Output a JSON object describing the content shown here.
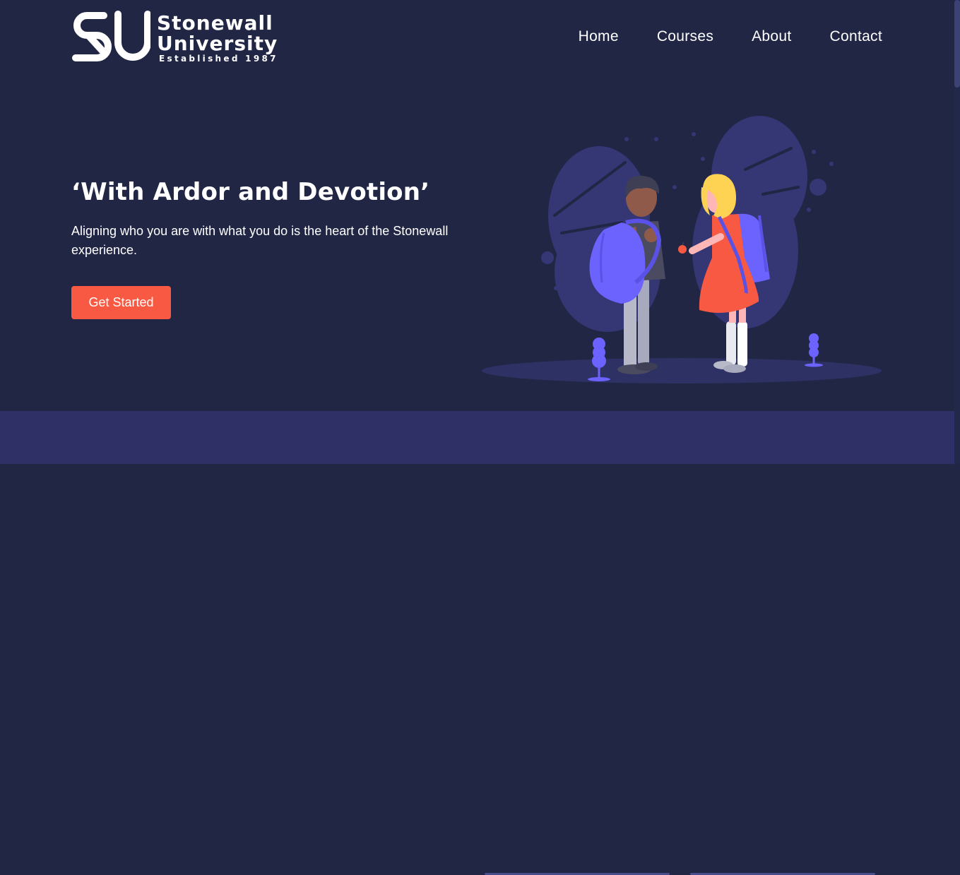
{
  "brand": {
    "name_line1": "Stonewall",
    "name_line2": "University",
    "established": "Established 1987",
    "monogram": "SU"
  },
  "nav": {
    "items": [
      {
        "label": "Home"
      },
      {
        "label": "Courses"
      },
      {
        "label": "About"
      },
      {
        "label": "Contact"
      }
    ]
  },
  "hero": {
    "title": "‘With Ardor and Devotion’",
    "text": "Aligning who you are with what you do is the heart of the Stonewall experience.",
    "cta_label": "Get Started"
  },
  "colors": {
    "background": "#212645",
    "accent": "#f75942",
    "illustration_purple": "#6c63ff",
    "section_band": "#2f3066"
  },
  "icons": [
    "su-monogram-logo",
    "students-illustration"
  ]
}
